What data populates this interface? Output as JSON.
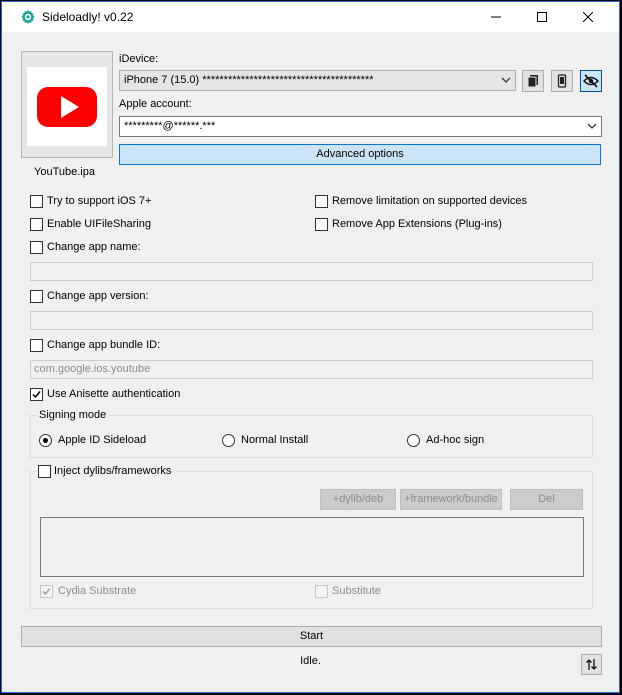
{
  "window": {
    "title": "Sideloadly! v0.22",
    "minimize_glyph": "—",
    "maximize_glyph": "☐",
    "close_glyph": "✕"
  },
  "app_preview": {
    "icon": "youtube-app-icon",
    "brand_color": "#ff0000",
    "filename": "YouTube.ipa"
  },
  "device": {
    "label": "iDevice:",
    "selected": "iPhone 7 (15.0) ****************************************"
  },
  "device_buttons": {
    "files_icon": "files-icon",
    "device_icon": "phone-icon",
    "hide_icon": "eye-slash-icon"
  },
  "account": {
    "label": "Apple account:",
    "value": "*********@******.***"
  },
  "advanced_button": "Advanced options",
  "options": {
    "ios7": "Try to support iOS 7+",
    "remove_limitation": "Remove limitation on supported devices",
    "uifilesharing": "Enable UIFileSharing",
    "remove_extensions": "Remove App Extensions (Plug-ins)",
    "change_name": "Change app name:",
    "change_version": "Change app version:",
    "change_bundle": "Change app bundle ID:",
    "bundle_placeholder": "com.google.ios.youtube",
    "anisette": "Use Anisette authentication"
  },
  "signing": {
    "title": "Signing mode",
    "apple_id": "Apple ID Sideload",
    "normal": "Normal Install",
    "adhoc": "Ad-hoc sign"
  },
  "inject": {
    "label": "Inject dylibs/frameworks",
    "add_dylib": "+dylib/deb",
    "add_framework": "+framework/bundle",
    "del": "Del",
    "cydia": "Cydia Substrate",
    "substitute": "Substitute"
  },
  "start_button": "Start",
  "status": "Idle.",
  "colors": {
    "accent": "#0078d7",
    "accent_fill": "#cce4f7",
    "window_bg": "#f0f0f0"
  }
}
